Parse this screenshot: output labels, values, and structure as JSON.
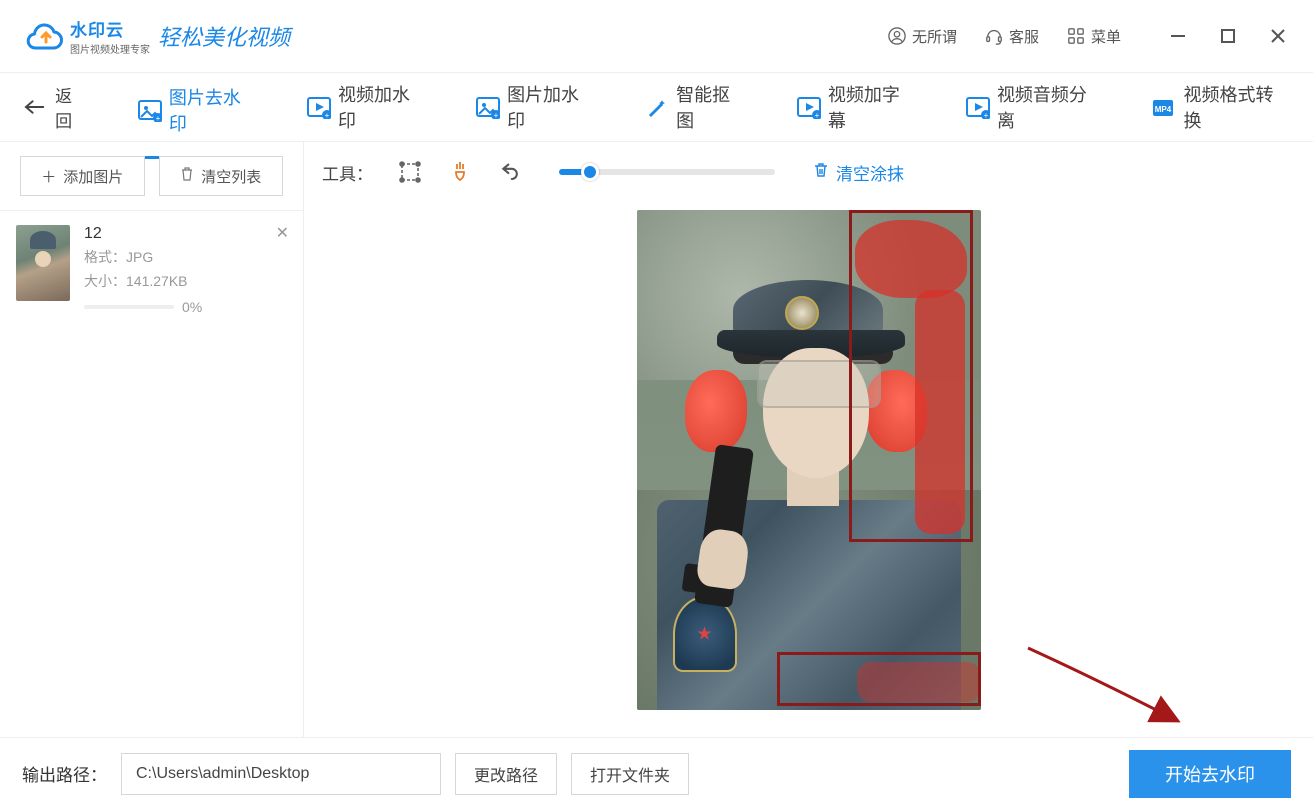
{
  "header": {
    "logo_main": "水印云",
    "logo_sub": "图片视频处理专家",
    "slogan": "轻松美化视频",
    "user": "无所谓",
    "service": "客服",
    "menu": "菜单"
  },
  "tabs": {
    "back": "返回",
    "items": [
      {
        "label": "图片去水印",
        "active": true
      },
      {
        "label": "视频加水印",
        "active": false
      },
      {
        "label": "图片加水印",
        "active": false
      },
      {
        "label": "智能抠图",
        "active": false
      },
      {
        "label": "视频加字幕",
        "active": false
      },
      {
        "label": "视频音频分离",
        "active": false
      },
      {
        "label": "视频格式转换",
        "active": false
      }
    ]
  },
  "sidebar": {
    "add_btn": "添加图片",
    "clear_btn": "清空列表",
    "file": {
      "name": "12",
      "format_label": "格式：",
      "format_value": "JPG",
      "size_label": "大小：",
      "size_value": "141.27KB",
      "progress": "0%"
    }
  },
  "toolbar": {
    "label": "工具：",
    "clear_brush": "清空涂抹",
    "slider_value": 13
  },
  "footer": {
    "path_label": "输出路径：",
    "path_value": "C:\\Users\\admin\\Desktop",
    "change_path": "更改路径",
    "open_folder": "打开文件夹",
    "start": "开始去水印"
  },
  "colors": {
    "accent": "#1b87e6",
    "selection_border": "#8a1b1b"
  }
}
